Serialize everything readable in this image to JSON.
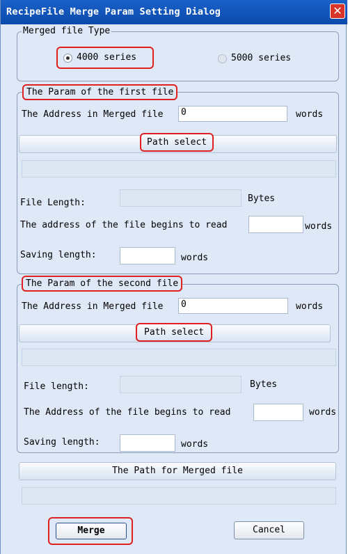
{
  "window": {
    "title": "RecipeFile Merge Param Setting Dialog",
    "close_glyph": "✕"
  },
  "file_type": {
    "legend": "Merged file Type",
    "option_4000": "4000 series",
    "option_5000": "5000 series",
    "selected": "4000 series"
  },
  "first_file": {
    "legend": "The Param of the first file",
    "address_label": "The Address in Merged file",
    "address_value": "0",
    "address_unit": "words",
    "path_select": "Path select",
    "path_value": "",
    "length_label": "File Length:",
    "length_value": "",
    "length_unit": "Bytes",
    "begin_label": "The address of the file begins to read",
    "begin_value": "",
    "begin_unit": "words",
    "saving_label": "Saving length:",
    "saving_value": "",
    "saving_unit": "words"
  },
  "second_file": {
    "legend": "The Param of the second file",
    "address_label": "The Address in Merged file",
    "address_value": "0",
    "address_unit": "words",
    "path_select": "Path select",
    "path_value": "",
    "length_label": "File length:",
    "length_value": "",
    "length_unit": "Bytes",
    "begin_label": "The Address of the file begins to read",
    "begin_value": "",
    "begin_unit": "words",
    "saving_label": "Saving length:",
    "saving_value": "",
    "saving_unit": "words"
  },
  "merged": {
    "path_button": "The Path for Merged file",
    "path_value": ""
  },
  "buttons": {
    "merge": "Merge",
    "cancel": "Cancel"
  }
}
